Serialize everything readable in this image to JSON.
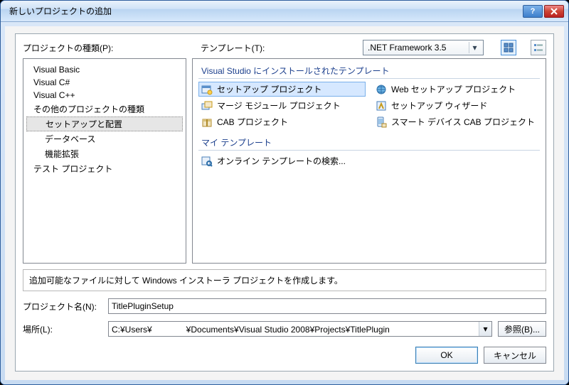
{
  "titlebar": {
    "title": "新しいプロジェクトの追加"
  },
  "labels": {
    "project_types": "プロジェクトの種類(P):",
    "templates": "テンプレート(T):",
    "description": "追加可能なファイルに対して Windows インストーラ プロジェクトを作成します。",
    "project_name": "プロジェクト名(N):",
    "location": "場所(L):"
  },
  "framework": {
    "selected": ".NET Framework 3.5"
  },
  "tree": {
    "items": [
      {
        "label": "Visual Basic",
        "level": 1
      },
      {
        "label": "Visual C#",
        "level": 1
      },
      {
        "label": "Visual C++",
        "level": 1
      },
      {
        "label": "その他のプロジェクトの種類",
        "level": 1
      },
      {
        "label": "セットアップと配置",
        "level": 2,
        "selected": true
      },
      {
        "label": "データベース",
        "level": 2
      },
      {
        "label": "機能拡張",
        "level": 2
      },
      {
        "label": "テスト プロジェクト",
        "level": 1
      }
    ]
  },
  "template_groups": [
    {
      "header": "Visual Studio にインストールされたテンプレート",
      "items": [
        {
          "label": "セットアップ プロジェクト",
          "icon": "setup",
          "selected": true
        },
        {
          "label": "Web セットアップ プロジェクト",
          "icon": "web"
        },
        {
          "label": "マージ モジュール プロジェクト",
          "icon": "merge"
        },
        {
          "label": "セットアップ ウィザード",
          "icon": "wizard"
        },
        {
          "label": "CAB プロジェクト",
          "icon": "cab"
        },
        {
          "label": "スマート デバイス CAB プロジェクト",
          "icon": "cab2"
        }
      ]
    },
    {
      "header": "マイ テンプレート",
      "items": [
        {
          "label": "オンライン テンプレートの検索...",
          "icon": "search"
        }
      ]
    }
  ],
  "form": {
    "project_name_value": "TitlePluginSetup",
    "location_value": "C:¥Users¥　　　　¥Documents¥Visual Studio 2008¥Projects¥TitlePlugin"
  },
  "buttons": {
    "browse": "参照(B)...",
    "ok": "OK",
    "cancel": "キャンセル"
  }
}
